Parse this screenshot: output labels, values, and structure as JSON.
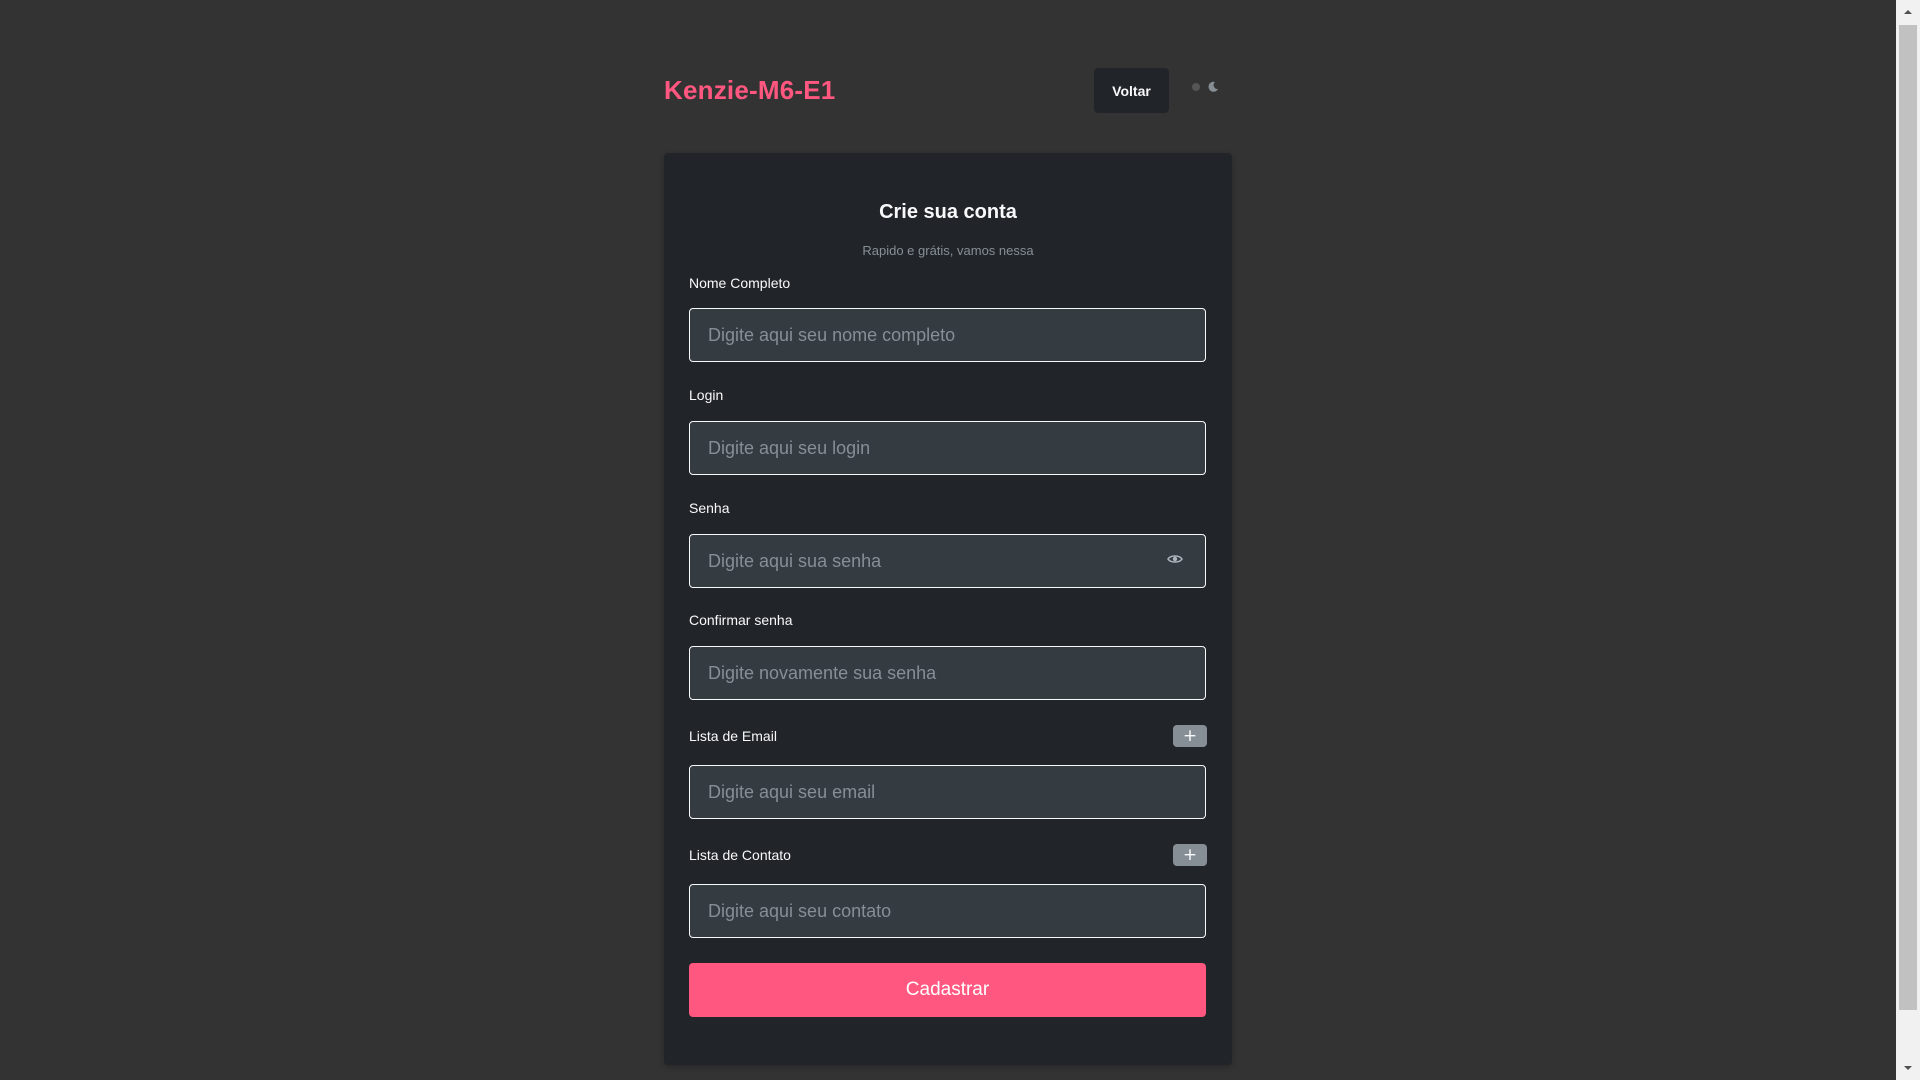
{
  "header": {
    "brand": "Kenzie-M6-E1",
    "back_label": "Voltar",
    "theme_toggle": {
      "icons": [
        "sun-icon",
        "moon-icon"
      ]
    }
  },
  "card": {
    "title": "Crie sua conta",
    "subtitle": "Rapido e grátis, vamos nessa"
  },
  "fields": {
    "full_name": {
      "label": "Nome Completo",
      "placeholder": "Digite aqui seu nome completo",
      "value": ""
    },
    "login": {
      "label": "Login",
      "placeholder": "Digite aqui seu login",
      "value": ""
    },
    "password": {
      "label": "Senha",
      "placeholder": "Digite aqui sua senha",
      "value": "",
      "icon": "eye-icon"
    },
    "confirm_password": {
      "label": "Confirmar senha",
      "placeholder": "Digite novamente sua senha",
      "value": ""
    },
    "emails": {
      "label": "Lista de Email",
      "placeholder": "Digite aqui seu email",
      "value": "",
      "add_label": "+"
    },
    "contacts": {
      "label": "Lista de Contato",
      "placeholder": "Digite aqui seu contato",
      "value": "",
      "add_label": "+"
    }
  },
  "submit_label": "Cadastrar",
  "colors": {
    "background": "#333333",
    "card": "#212529",
    "input": "#343b41",
    "brand": "#ff577f",
    "primary_button": "#ff577f",
    "muted": "#868e96",
    "text": "#f8f9fa"
  }
}
